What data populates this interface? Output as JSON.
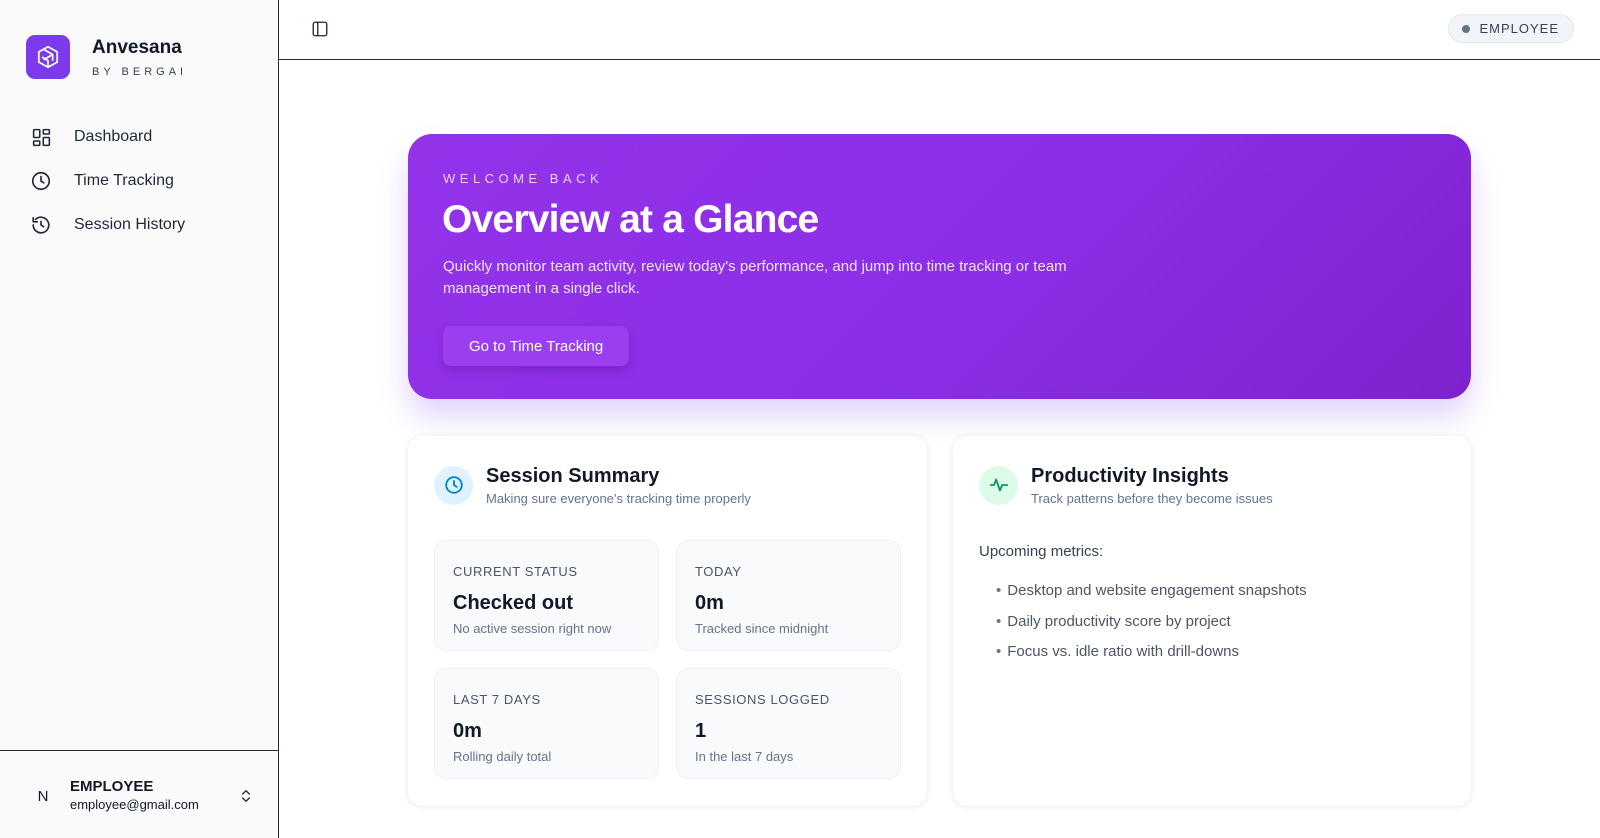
{
  "brand": {
    "name": "Anvesana",
    "sub": "BY BERGAI",
    "accent": "#7c3aed"
  },
  "nav": {
    "items": [
      {
        "label": "Dashboard",
        "icon": "dashboard-icon"
      },
      {
        "label": "Time Tracking",
        "icon": "clock-icon"
      },
      {
        "label": "Session History",
        "icon": "history-icon"
      }
    ]
  },
  "user": {
    "initial": "N",
    "role": "EMPLOYEE",
    "email": "employee@gmail.com"
  },
  "topbar": {
    "role_badge": "EMPLOYEE"
  },
  "hero": {
    "eyebrow": "WELCOME BACK",
    "title": "Overview at a Glance",
    "description": "Quickly monitor team activity, review today's performance, and jump into time tracking or team management in a single click.",
    "cta": "Go to Time Tracking"
  },
  "session_summary": {
    "title": "Session Summary",
    "subtitle": "Making sure everyone’s tracking time properly",
    "stats": [
      {
        "label": "CURRENT STATUS",
        "value": "Checked out",
        "note": "No active session right now"
      },
      {
        "label": "TODAY",
        "value": "0m",
        "note": "Tracked since midnight"
      },
      {
        "label": "LAST 7 DAYS",
        "value": "0m",
        "note": "Rolling daily total"
      },
      {
        "label": "SESSIONS LOGGED",
        "value": "1",
        "note": "In the last 7 days"
      }
    ]
  },
  "insights": {
    "title": "Productivity Insights",
    "subtitle": "Track patterns before they become issues",
    "metrics_title": "Upcoming metrics:",
    "metrics": [
      "Desktop and website engagement snapshots",
      "Daily productivity score by project",
      "Focus vs. idle ratio with drill-downs"
    ]
  }
}
